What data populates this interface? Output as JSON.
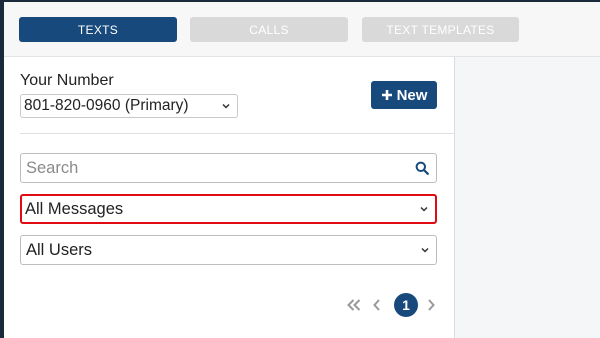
{
  "tabs": [
    {
      "label": "TEXTS",
      "active": true
    },
    {
      "label": "CALLS",
      "active": false
    },
    {
      "label": "TEXT TEMPLATES",
      "active": false
    }
  ],
  "number": {
    "label": "Your Number",
    "selected": "801-820-0960 (Primary)"
  },
  "new_button": {
    "label": "New",
    "icon": "plus-icon"
  },
  "search": {
    "placeholder": "Search",
    "icon": "search-icon"
  },
  "filters": {
    "messages": "All Messages",
    "users": "All Users"
  },
  "pagination": {
    "current": "1"
  },
  "colors": {
    "primary": "#17497d",
    "highlight_border": "#e10b13",
    "inactive_tab": "#d9d9d9",
    "panel_bg": "#f5f6f7"
  }
}
